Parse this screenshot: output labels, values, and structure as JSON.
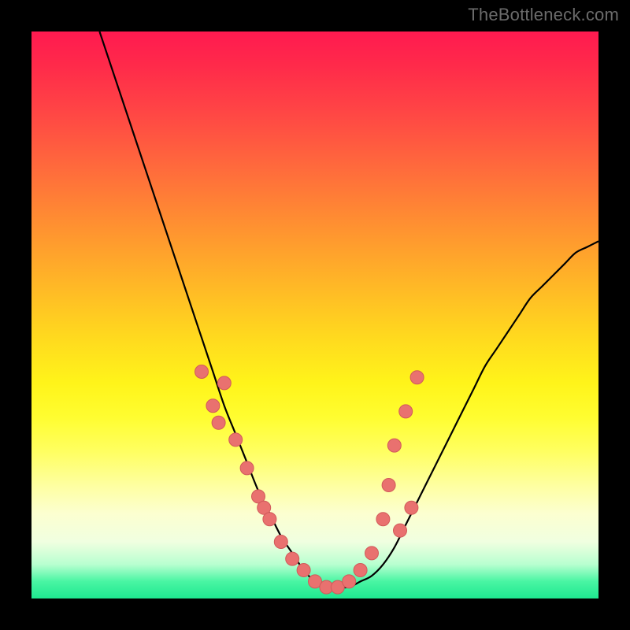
{
  "watermark": "TheBottleneck.com",
  "colors": {
    "background": "#000000",
    "curve": "#000000",
    "dot_fill": "#e9716f",
    "dot_stroke": "#d15a5a"
  },
  "chart_data": {
    "type": "line",
    "title": "",
    "xlabel": "",
    "ylabel": "",
    "xlim": [
      0,
      100
    ],
    "ylim": [
      0,
      100
    ],
    "series": [
      {
        "name": "bottleneck-curve",
        "x": [
          12,
          14,
          16,
          18,
          20,
          22,
          24,
          26,
          28,
          30,
          32,
          34,
          36,
          38,
          40,
          42,
          44,
          46,
          48,
          50,
          52,
          54,
          56,
          58,
          60,
          62,
          64,
          66,
          68,
          70,
          72,
          74,
          76,
          78,
          80,
          82,
          84,
          86,
          88,
          90,
          92,
          94,
          96,
          98,
          100
        ],
        "values": [
          100,
          94,
          88,
          82,
          76,
          70,
          64,
          58,
          52,
          46,
          40,
          34,
          29,
          24,
          19,
          15,
          11,
          8,
          5,
          3,
          2,
          2,
          2,
          3,
          4,
          6,
          9,
          13,
          17,
          21,
          25,
          29,
          33,
          37,
          41,
          44,
          47,
          50,
          53,
          55,
          57,
          59,
          61,
          62,
          63
        ]
      }
    ],
    "dots": {
      "x": [
        30,
        32,
        33,
        34,
        36,
        38,
        40,
        41,
        42,
        44,
        46,
        48,
        50,
        52,
        54,
        56,
        58,
        60,
        62,
        63,
        64,
        65,
        66,
        67,
        68
      ],
      "values": [
        40,
        34,
        31,
        38,
        28,
        23,
        18,
        16,
        14,
        10,
        7,
        5,
        3,
        2,
        2,
        3,
        5,
        8,
        14,
        20,
        27,
        12,
        33,
        16,
        39
      ]
    }
  }
}
